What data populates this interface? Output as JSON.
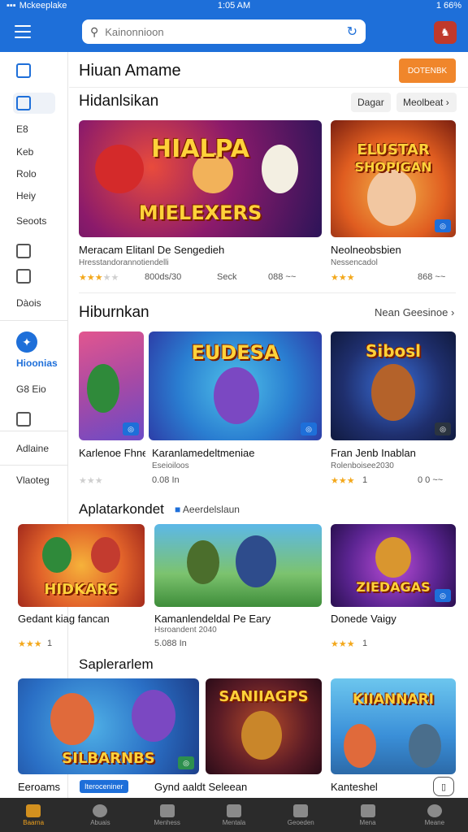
{
  "status": {
    "left": "Mckeeplake",
    "time": "1:05 AM",
    "battery": "1 66%"
  },
  "search": {
    "placeholder": "Kainonnioon"
  },
  "header": {
    "title": "Hiuan Amame",
    "button": "DOTENBK"
  },
  "sidebar": {
    "items": [
      {
        "label": "E8"
      },
      {
        "label": "Keb"
      },
      {
        "label": "Rolo"
      },
      {
        "label": "Heiy"
      },
      {
        "label": "Seoots"
      },
      {
        "label": "Dàois"
      },
      {
        "label": "Hioonias"
      },
      {
        "label": "G8 Eio"
      },
      {
        "label": "Adlaine"
      },
      {
        "label": "Vlaoteg"
      }
    ]
  },
  "section1": {
    "title": "Hidanlsikan",
    "filter_a": "Dagar",
    "filter_b": "Meolbeat",
    "cards": [
      {
        "name": "Meracam Elitanl De Sengedieh",
        "sub": "Hresstandorannotiendelli",
        "thumb_text_1": "HIALPA",
        "thumb_text_2": "MIELEXERS",
        "rating": 3,
        "meta1": "800ds/30",
        "meta2": "Seck",
        "meta3": "088 ~~"
      },
      {
        "name": "Neolneobsbien",
        "sub": "Nessencadol",
        "thumb_text_1": "ELUSTAR",
        "thumb_text_2": "SHOPIGAN",
        "rating": 3,
        "meta1": "868 ~~"
      }
    ]
  },
  "section2": {
    "title": "Hiburnkan",
    "more": "Nean Geesinoe",
    "cards": [
      {
        "name": "Karlenoe Fhne",
        "thumb_text": "",
        "rating": 3,
        "meta1": ""
      },
      {
        "name": "Karanlamedeltmeniae",
        "sub": "Eseioiloos",
        "thumb_text": "EUDESA",
        "rating": 3,
        "meta1": "0.08 In"
      },
      {
        "name": "Fran Jenb Inablan",
        "sub": "Rolenboisee2030",
        "thumb_text": "Sibosl",
        "rating": 3,
        "meta1": "1",
        "meta2": "0 0 ~~"
      }
    ]
  },
  "section3": {
    "title": "Aplatarkondet",
    "subtitle": "Aeerdelslaun",
    "cards": [
      {
        "name": "Gedant kiag fancan",
        "thumb_text": "HIDKARS",
        "rating": 3,
        "meta1": "1"
      },
      {
        "name": "Kamanlendeldal Pe Eary",
        "sub": "Hsroandent 2040",
        "thumb_text": "",
        "rating": 0,
        "meta1": "5.088 In"
      },
      {
        "name": "Donede Vaigy",
        "thumb_text": "ZIEDAGAS",
        "rating": 3,
        "meta1": "1"
      }
    ]
  },
  "section4": {
    "title": "Saplerarlem",
    "cards": [
      {
        "name": "Eeroams",
        "badge": "Iteroceniner",
        "thumb_text": "SILBARNBS"
      },
      {
        "name": "Gynd aaldt Seleean",
        "thumb_text": "SANIIAGPS"
      },
      {
        "name": "Kanteshel",
        "thumb_text": "KIIANNARI"
      }
    ]
  },
  "nav": [
    {
      "label": "Baarna",
      "active": true
    },
    {
      "label": "Abuais"
    },
    {
      "label": "Menhess"
    },
    {
      "label": "Mentala"
    },
    {
      "label": "Geoeden"
    },
    {
      "label": "Mena"
    },
    {
      "label": "Meane"
    }
  ]
}
